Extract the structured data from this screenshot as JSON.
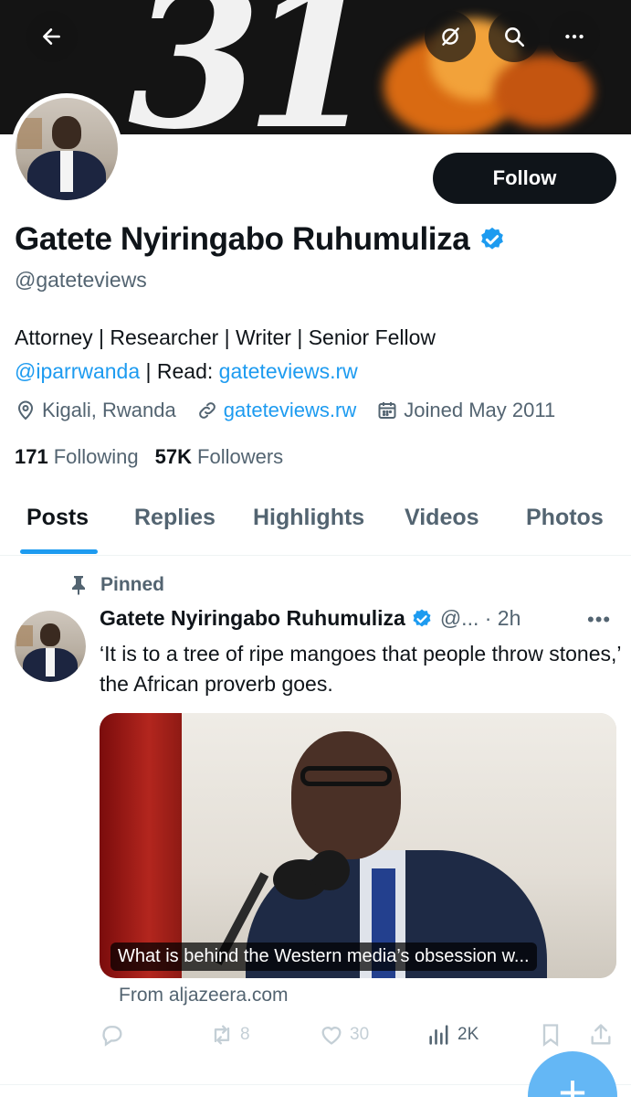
{
  "header": {
    "back_icon": "arrow-left-icon",
    "grok_icon": "grok-icon",
    "search_icon": "search-icon",
    "more_icon": "more-horizontal-icon",
    "banner_text": "31"
  },
  "profile": {
    "follow_label": "Follow",
    "name": "Gatete Nyiringabo Ruhumuliza",
    "handle": "@gateteviews",
    "bio_line1": "Attorney | Researcher | Writer | Senior Fellow",
    "bio_mention": "@iparrwanda",
    "bio_read": " | Read: ",
    "bio_link": "gateteviews.rw",
    "location": "Kigali, Rwanda",
    "website": "gateteviews.rw",
    "joined": "Joined May 2011",
    "following_count": "171",
    "following_label": "Following",
    "followers_count": "57K",
    "followers_label": "Followers"
  },
  "tabs": [
    "Posts",
    "Replies",
    "Highlights",
    "Videos",
    "Photos"
  ],
  "post": {
    "pinned_label": "Pinned",
    "author": "Gatete Nyiringabo Ruhumuliza",
    "meta": "@... · 2h",
    "more": "•••",
    "text": "‘It is to a tree of ripe mangoes that people throw stones,’ the African proverb goes.",
    "card_caption": "What is behind the Western media’s obsession w...",
    "card_source": "From aljazeera.com",
    "replies": "",
    "reposts": "8",
    "likes": "30",
    "views": "2K"
  },
  "colors": {
    "accent": "#1d9bf0",
    "text": "#0f1419",
    "muted": "#536471",
    "button_dark": "#0f1419"
  }
}
